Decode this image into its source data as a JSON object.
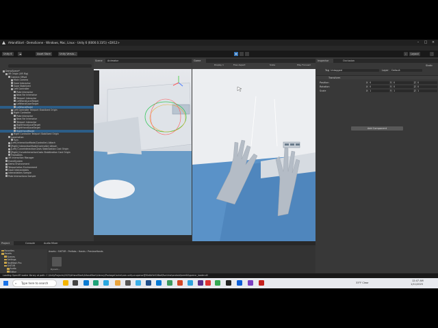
{
  "window": {
    "title": "AHandStart - DemoScene - Windows, Mac, Linux - Unity 6 (6000.0.31f1) <DX12>"
  },
  "menu": [
    "File",
    "Edit",
    "Assets",
    "GameObject",
    "Component",
    "Services",
    "Jobs",
    "Window",
    "Help"
  ],
  "toolbar": {
    "account": "Unity 6",
    "asset_store": "Asset Store",
    "version_control": "Unity Versio...",
    "layout": "Layout"
  },
  "hierarchy": {
    "tab": "Hierarchy",
    "rows": [
      {
        "text": "DemoScene*",
        "indent": 0,
        "sel": false
      },
      {
        "text": "XR Origin (XR Rig)",
        "indent": 1,
        "sel": false
      },
      {
        "text": "Camera Offset",
        "indent": 2,
        "sel": false
      },
      {
        "text": "Main Camera",
        "indent": 3,
        "sel": false
      },
      {
        "text": "Gaze Interactor",
        "indent": 3,
        "sel": false
      },
      {
        "text": "Gaze Stabilized",
        "indent": 3,
        "sel": false
      },
      {
        "text": "Left Controller",
        "indent": 3,
        "sel": false
      },
      {
        "text": "Poke Interactor",
        "indent": 4,
        "sel": false
      },
      {
        "text": "Near-Far Interactor",
        "indent": 4,
        "sel": false
      },
      {
        "text": "Teleport Interactor",
        "indent": 4,
        "sel": false
      },
      {
        "text": "LeftHandLocalTarget",
        "indent": 4,
        "sel": false
      },
      {
        "text": "LeftHandGazeTarget",
        "indent": 4,
        "sel": false
      },
      {
        "text": "LeftHandModel",
        "indent": 4,
        "sel": true
      },
      {
        "text": "Left Controller Teleport Stabilized Origin",
        "indent": 3,
        "sel": false
      },
      {
        "text": "Right Controller",
        "indent": 3,
        "sel": false
      },
      {
        "text": "Poke Interactor",
        "indent": 4,
        "sel": false
      },
      {
        "text": "Near-Far Interactor",
        "indent": 4,
        "sel": false
      },
      {
        "text": "Teleport Interactor",
        "indent": 4,
        "sel": false
      },
      {
        "text": "RightHandLocalTarget",
        "indent": 4,
        "sel": false
      },
      {
        "text": "RightHandGazeTarget",
        "indent": 4,
        "sel": false
      },
      {
        "text": "RightHandModel",
        "indent": 4,
        "sel": true
      },
      {
        "text": "Right Controller Teleport Stabilized Origin",
        "indent": 3,
        "sel": false
      },
      {
        "text": "Locomotion",
        "indent": 2,
        "sel": false
      },
      {
        "text": "Turn",
        "indent": 3,
        "sel": false
      },
      {
        "text": "[Left] InteractionMode(Controller) Attach",
        "indent": 2,
        "sel": false
      },
      {
        "text": "[Right] InteractionMode(Controller) Attach",
        "indent": 2,
        "sel": false
      },
      {
        "text": "[Left] CurveInteractionCasts Stabilization Cast Origin",
        "indent": 2,
        "sel": false
      },
      {
        "text": "[Right] CurveInteractionCasts Stabilization Cast Origin",
        "indent": 2,
        "sel": false
      },
      {
        "text": "Trackables",
        "indent": 2,
        "sel": false
      },
      {
        "text": "XR Interaction Manager",
        "indent": 1,
        "sel": false
      },
      {
        "text": "EventSystem",
        "indent": 1,
        "sel": false
      },
      {
        "text": "Demo Environment",
        "indent": 1,
        "sel": false
      },
      {
        "text": "Teleportation Environment",
        "indent": 1,
        "sel": false
      },
      {
        "text": "Gaze Interactables",
        "indent": 1,
        "sel": false
      },
      {
        "text": "Interactables Sample",
        "indent": 1,
        "sel": false
      },
      {
        "text": "Poke Interactions Sample",
        "indent": 1,
        "sel": false
      }
    ]
  },
  "scene": {
    "tabs": [
      "Scene",
      "Animator"
    ]
  },
  "game": {
    "tab": "Game",
    "display": "Display 1",
    "aspect": "Free Aspect",
    "scale": "Scale",
    "play_focused": "Play Focused"
  },
  "inspector": {
    "tabs": [
      "Inspector",
      "Occlusion"
    ],
    "static": "Static",
    "tag_label": "Tag",
    "tag_value": "Untagged",
    "layer_label": "Layer",
    "layer_value": "Default",
    "transform_label": "Transform",
    "rows": [
      {
        "label": "Position",
        "x": "0",
        "y": "0",
        "z": "0"
      },
      {
        "label": "Rotation",
        "x": "0",
        "y": "0",
        "z": "0"
      },
      {
        "label": "Scale",
        "x": "1",
        "y": "1",
        "z": "1"
      }
    ],
    "add_component": "Add Component"
  },
  "project": {
    "tabs": [
      "Project",
      "Console",
      "Audio Mixer"
    ],
    "breadcrumb": "Assets › SHITVR › Prefabs › Hands › PreviewHands",
    "tree": [
      {
        "text": "Favorites",
        "indent": 0,
        "sel": false
      },
      {
        "text": "Assets",
        "indent": 0,
        "sel": false
      },
      {
        "text": "Scenes",
        "indent": 1,
        "sel": false
      },
      {
        "text": "Settings",
        "indent": 1,
        "sel": false
      },
      {
        "text": "TextMesh Pro",
        "indent": 1,
        "sel": false
      },
      {
        "text": "SHITVR",
        "indent": 1,
        "sel": false
      },
      {
        "text": "Audio",
        "indent": 2,
        "sel": false
      },
      {
        "text": "Editor",
        "indent": 2,
        "sel": false
      },
      {
        "text": "RiggedHands",
        "indent": 2,
        "sel": false
      },
      {
        "text": "Animations",
        "indent": 3,
        "sel": false
      },
      {
        "text": "OculusHands",
        "indent": 2,
        "sel": false
      },
      {
        "text": "Prefabs",
        "indent": 2,
        "sel": false
      },
      {
        "text": "Hands",
        "indent": 3,
        "sel": false
      },
      {
        "text": "PreviewHands",
        "indent": 4,
        "sel": true
      },
      {
        "text": "Scripts",
        "indent": 2,
        "sel": false
      },
      {
        "text": "Samples",
        "indent": 1,
        "sel": false
      },
      {
        "text": "HandPoses",
        "indent": 2,
        "sel": false
      },
      {
        "text": "HandModel",
        "indent": 3,
        "sel": false
      },
      {
        "text": "HandPoseRecords",
        "indent": 3,
        "sel": false
      }
    ],
    "asset_label": "Dynam..."
  },
  "status": "Loading OpenXR loader library at path: C:\\UnityProjects\\2025\\AHandStart\\AHandStart\\Library\\PackageCache\\com.unity.xr.openxr@f0e8d3e528bd\\Runtime\\android\\arm64\\openxr_loader.dll",
  "taskbar": {
    "search_placeholder": "Type here to search",
    "weather": "33°F  Clear",
    "time": "12:47 AM",
    "date": "1/11/2025"
  }
}
